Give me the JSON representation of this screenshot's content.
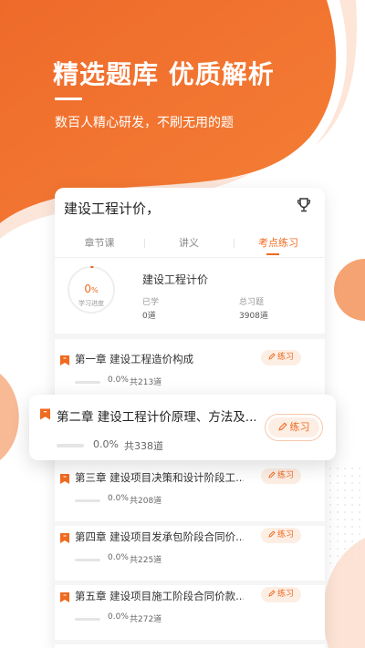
{
  "banner": {
    "headline": "精选题库 优质解析",
    "tagline": "数百人精心研发，不刷无用的题",
    "accent_color": "#f06a20"
  },
  "card": {
    "title": "建设工程计价，",
    "trophy_icon": "trophy-icon",
    "tabs": [
      {
        "label": "章节课",
        "active": false
      },
      {
        "label": "讲义",
        "active": false
      },
      {
        "label": "考点练习",
        "active": true
      }
    ],
    "summary": {
      "progress_value": "0",
      "progress_unit": "%",
      "progress_fraction": 0,
      "progress_label": "学习进度",
      "title": "建设工程计价",
      "studied_label": "已学",
      "studied_value": "0道",
      "total_label": "总习题",
      "total_value": "3908道"
    },
    "chapters": [
      {
        "title": "第一章 建设工程造价构成",
        "percent": "0.0%",
        "total": "共213道",
        "button": "练习"
      },
      {
        "title": "第二章 建设工程计价原理、方法及...",
        "percent": "0.0%",
        "total": "共338道",
        "button": "练习",
        "highlighted": true
      },
      {
        "title": "第三章 建设项目决策和设计阶段工...",
        "percent": "0.0%",
        "total": "共208道",
        "button": "练习"
      },
      {
        "title": "第四章 建设项目发承包阶段合同价...",
        "percent": "0.0%",
        "total": "共225道",
        "button": "练习"
      },
      {
        "title": "第五章 建设项目施工阶段合同价款...",
        "percent": "0.0%",
        "total": "共272道",
        "button": "练习"
      }
    ]
  }
}
